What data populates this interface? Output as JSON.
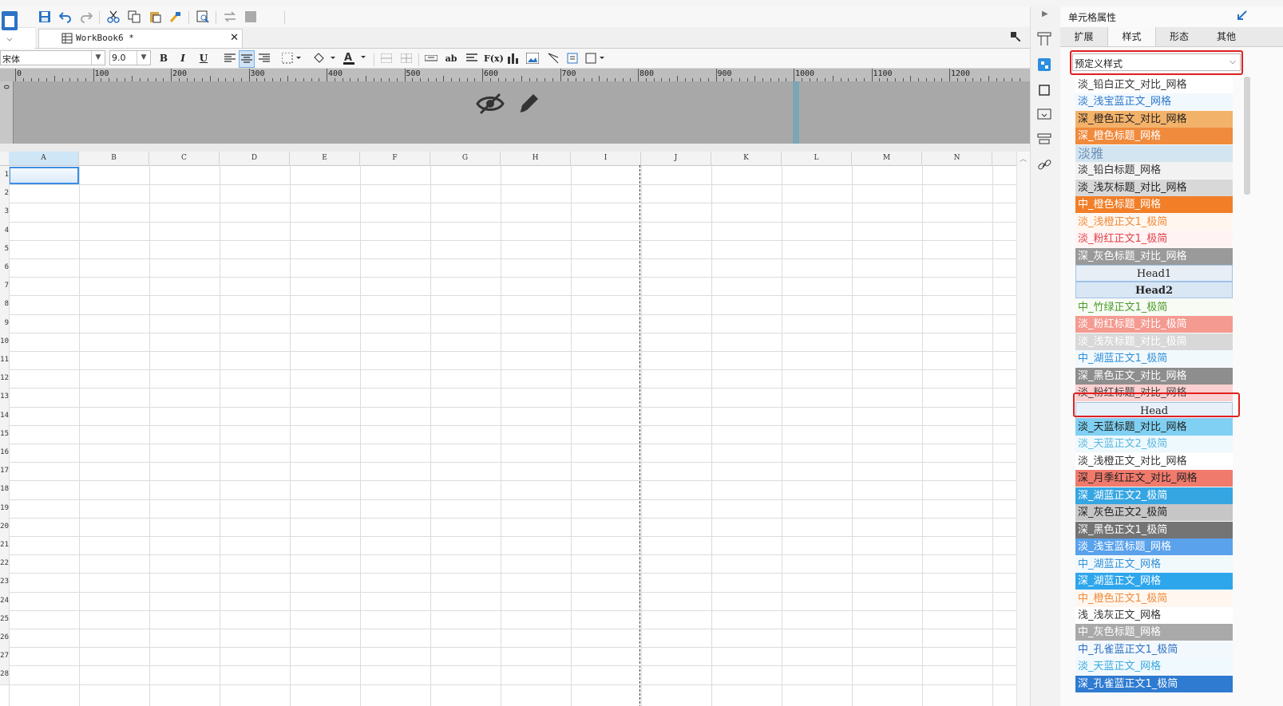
{
  "window": {
    "document_tab": "WorkBook6 *"
  },
  "format_toolbar": {
    "font": "宋体",
    "font_size": "9.0",
    "bold": "B",
    "italic": "I",
    "underline": "U",
    "ab": "ab",
    "fx": "F(x)"
  },
  "ruler": {
    "labels": [
      "0",
      "100",
      "200",
      "300",
      "400",
      "500",
      "600",
      "700",
      "800",
      "900",
      "1000",
      "1100",
      "1200"
    ]
  },
  "grid": {
    "columns": [
      "A",
      "B",
      "C",
      "D",
      "E",
      "F",
      "G",
      "H",
      "I",
      "J",
      "K",
      "L",
      "M",
      "N"
    ],
    "rows": [
      "1",
      "2",
      "3",
      "4",
      "5",
      "6",
      "7",
      "8",
      "9",
      "10",
      "11",
      "12",
      "13",
      "14",
      "15",
      "16",
      "17",
      "18",
      "19",
      "20",
      "21",
      "22",
      "23",
      "24",
      "25",
      "26",
      "27",
      "28"
    ],
    "selected_cell": "A1"
  },
  "panel": {
    "title": "单元格属性",
    "tabs": [
      "扩展",
      "样式",
      "形态",
      "其他"
    ],
    "active_tab": "样式",
    "dropdown_value": "预定义样式",
    "styles": [
      {
        "label": "淡_铅白正文_对比_网格",
        "bg": "#ffffff",
        "fg": "#333333",
        "bold": false,
        "center": false,
        "size": 13
      },
      {
        "label": "淡_浅宝蓝正文_网格",
        "bg": "#f1f8fe",
        "fg": "#2b77c9",
        "bold": false,
        "center": false,
        "size": 13
      },
      {
        "label": "深_橙色正文_对比_网格",
        "bg": "#f3b26a",
        "fg": "#222222",
        "bold": false,
        "center": false,
        "size": 13
      },
      {
        "label": "深_橙色标题_网格",
        "bg": "#f08a3c",
        "fg": "#ffffff",
        "bold": false,
        "center": false,
        "size": 13
      },
      {
        "label": "淡雅",
        "bg": "#d3e5f1",
        "fg": "#6a8fb5",
        "bold": false,
        "center": false,
        "size": 16
      },
      {
        "label": "淡_铅白标题_网格",
        "bg": "#f2f2f2",
        "fg": "#333333",
        "bold": false,
        "center": false,
        "size": 13
      },
      {
        "label": "淡_浅灰标题_对比_网格",
        "bg": "#d8d8d8",
        "fg": "#222222",
        "bold": false,
        "center": false,
        "size": 13
      },
      {
        "label": "中_橙色标题_网格",
        "bg": "#f27e28",
        "fg": "#ffffff",
        "bold": false,
        "center": false,
        "size": 13
      },
      {
        "label": "淡_浅橙正文1_极简",
        "bg": "#fff7ef",
        "fg": "#f08a3c",
        "bold": false,
        "center": false,
        "size": 13
      },
      {
        "label": "淡_粉红正文1_极简",
        "bg": "#fff3f3",
        "fg": "#e2414b",
        "bold": false,
        "center": false,
        "size": 13
      },
      {
        "label": "深_灰色标题_对比_网格",
        "bg": "#9a9a9a",
        "fg": "#ffffff",
        "bold": false,
        "center": false,
        "size": 13
      },
      {
        "label": "Head1",
        "bg": "#e7eef6",
        "fg": "#222222",
        "bold": false,
        "center": true,
        "size": 13
      },
      {
        "label": "Head2",
        "bg": "#d9e7f4",
        "fg": "#222222",
        "bold": true,
        "center": true,
        "size": 13
      },
      {
        "label": "中_竹绿正文1_极简",
        "bg": "#f7fbf4",
        "fg": "#4b9b2b",
        "bold": false,
        "center": false,
        "size": 13
      },
      {
        "label": "淡_粉红标题_对比_极简",
        "bg": "#f49a90",
        "fg": "#ffffff",
        "bold": false,
        "center": false,
        "size": 13
      },
      {
        "label": "淡_浅灰标题_对比_极简",
        "bg": "#d8d8d8",
        "fg": "#ffffff",
        "bold": false,
        "center": false,
        "size": 13
      },
      {
        "label": "中_湖蓝正文1_极简",
        "bg": "#f2f9fd",
        "fg": "#2f8fd8",
        "bold": false,
        "center": false,
        "size": 13
      },
      {
        "label": "深_黑色正文_对比_网格",
        "bg": "#8e8e8e",
        "fg": "#ffffff",
        "bold": false,
        "center": false,
        "size": 13
      },
      {
        "label": "淡_粉红标题_对比_网格",
        "bg": "#fbd0d0",
        "fg": "#444444",
        "bold": false,
        "center": false,
        "size": 13
      },
      {
        "label": "Head",
        "bg": "#e8f1fa",
        "fg": "#222222",
        "bold": false,
        "center": true,
        "size": 13
      },
      {
        "label": "淡_天蓝标题_对比_网格",
        "bg": "#7fd0f2",
        "fg": "#222222",
        "bold": false,
        "center": false,
        "size": 13
      },
      {
        "label": "淡_天蓝正文2_极简",
        "bg": "#eef9fd",
        "fg": "#5ab6e0",
        "bold": false,
        "center": false,
        "size": 13
      },
      {
        "label": "淡_浅橙正文_对比_网格",
        "bg": "#ffffff",
        "fg": "#333333",
        "bold": false,
        "center": false,
        "size": 13
      },
      {
        "label": "深_月季红正文_对比_网格",
        "bg": "#f07a6c",
        "fg": "#222222",
        "bold": false,
        "center": false,
        "size": 13
      },
      {
        "label": "深_湖蓝正文2_极简",
        "bg": "#36a6e3",
        "fg": "#ffffff",
        "bold": false,
        "center": false,
        "size": 13
      },
      {
        "label": "深_灰色正文2_极简",
        "bg": "#c6c6c6",
        "fg": "#222222",
        "bold": false,
        "center": false,
        "size": 13
      },
      {
        "label": "深_黑色正文1_极简",
        "bg": "#747474",
        "fg": "#ffffff",
        "bold": false,
        "center": false,
        "size": 13
      },
      {
        "label": "淡_浅宝蓝标题_网格",
        "bg": "#5aa2ec",
        "fg": "#ffffff",
        "bold": false,
        "center": false,
        "size": 13
      },
      {
        "label": "中_湖蓝正文_网格",
        "bg": "#f2f9fd",
        "fg": "#2f8fd8",
        "bold": false,
        "center": false,
        "size": 13
      },
      {
        "label": "深_湖蓝正文_网格",
        "bg": "#2ea6ec",
        "fg": "#ffffff",
        "bold": false,
        "center": false,
        "size": 13
      },
      {
        "label": "中_橙色正文1_极简",
        "bg": "#fff7ef",
        "fg": "#f08a3c",
        "bold": false,
        "center": false,
        "size": 13
      },
      {
        "label": "浅_浅灰正文_网格",
        "bg": "#ffffff",
        "fg": "#333333",
        "bold": false,
        "center": false,
        "size": 13
      },
      {
        "label": "中_灰色标题_网格",
        "bg": "#a9a9a9",
        "fg": "#ffffff",
        "bold": false,
        "center": false,
        "size": 13
      },
      {
        "label": "中_孔雀蓝正文1_极简",
        "bg": "#f3f8fd",
        "fg": "#2a6fc2",
        "bold": false,
        "center": false,
        "size": 13
      },
      {
        "label": "淡_天蓝正文_网格",
        "bg": "#f0f9fd",
        "fg": "#3aa8de",
        "bold": false,
        "center": false,
        "size": 13
      },
      {
        "label": "深_孔雀蓝正文1_极简",
        "bg": "#2e7bd1",
        "fg": "#ffffff",
        "bold": false,
        "center": false,
        "size": 13
      }
    ]
  }
}
